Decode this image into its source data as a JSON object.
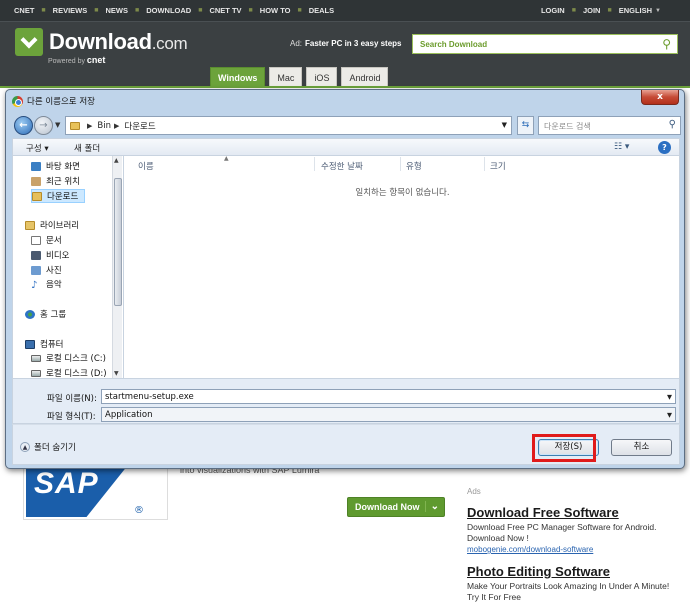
{
  "site": {
    "nav_left": [
      "CNET",
      "REVIEWS",
      "NEWS",
      "DOWNLOAD",
      "CNET TV",
      "HOW TO",
      "DEALS"
    ],
    "nav_right": [
      "LOGIN",
      "JOIN",
      "ENGLISH"
    ],
    "logo_main": "Download",
    "logo_suffix": ".com",
    "powered_prefix": "Powered by",
    "powered_brand": "cnet",
    "ad_label": "Ad:",
    "ad_text": "Faster PC in 3 easy steps",
    "search_placeholder": "Search Download",
    "tabs": [
      "Windows",
      "Mac",
      "iOS",
      "Android"
    ],
    "active_tab": "Windows",
    "sap_text": "SAP",
    "sap_reg": "®",
    "promo_text": "into visualizations with SAP Lumira",
    "download_now": "Download Now",
    "ads_label": "Ads",
    "ads": [
      {
        "title": "Download Free Software",
        "desc": "Download Free PC Manager Software for Android. Download Now !",
        "url": "mobogenie.com/download-software"
      },
      {
        "title": "Photo Editing Software",
        "desc": "Make Your Portraits Look Amazing In Under A Minute! Try It For Free",
        "url": ""
      }
    ]
  },
  "dialog": {
    "title": "다른 이름으로 저장",
    "close_label": "x",
    "path": [
      "Bin",
      "다운로드"
    ],
    "search_placeholder": "다운로드 검색",
    "toolbar": {
      "organize": "구성 ▾",
      "new_folder": "새 폴더"
    },
    "nav_items": [
      {
        "label": "바탕 화면",
        "icon": "desktop-icon"
      },
      {
        "label": "최근 위치",
        "icon": "recent-places-icon"
      },
      {
        "label": "다운로드",
        "icon": "downloads-folder-icon",
        "selected": true
      },
      {
        "label": "라이브러리",
        "icon": "library-icon"
      },
      {
        "label": "문서",
        "icon": "documents-icon"
      },
      {
        "label": "비디오",
        "icon": "videos-icon"
      },
      {
        "label": "사진",
        "icon": "pictures-icon"
      },
      {
        "label": "음악",
        "icon": "music-icon"
      },
      {
        "label": "홈 그룹",
        "icon": "homegroup-icon"
      },
      {
        "label": "컴퓨터",
        "icon": "computer-icon"
      },
      {
        "label": "로컬 디스크 (C:)",
        "icon": "local-disk-icon"
      },
      {
        "label": "로컬 디스크 (D:)",
        "icon": "local-disk-icon"
      }
    ],
    "columns": [
      "이름",
      "수정한 날짜",
      "유형",
      "크기"
    ],
    "empty_message": "일치하는 항목이 없습니다.",
    "filename_label": "파일 이름(N):",
    "filename_value": "startmenu-setup.exe",
    "filetype_label": "파일 형식(T):",
    "filetype_value": "Application",
    "hide_folders": "폴더 숨기기",
    "save_button": "저장(S)",
    "cancel_button": "취소"
  },
  "colors": {
    "brand_green": "#6ca33b",
    "highlight_red": "#e01b1b"
  }
}
